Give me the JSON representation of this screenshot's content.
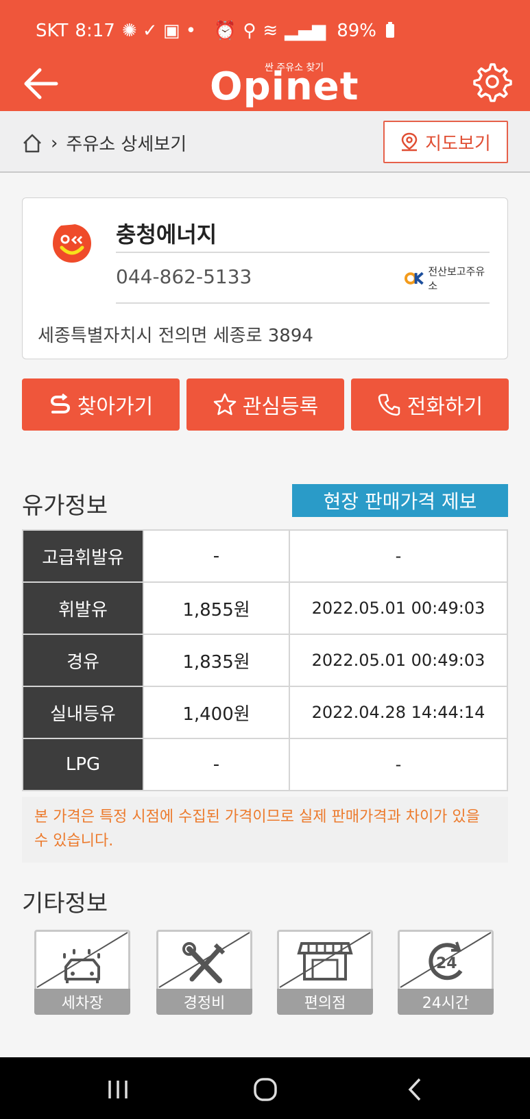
{
  "status_bar": {
    "carrier": "SKT",
    "time": "8:17",
    "battery": "89%"
  },
  "header": {
    "logo_sub": "싼 주유소 찾기",
    "logo_main": "Opinet"
  },
  "breadcrumb": {
    "current": "주유소 상세보기",
    "map_button": "지도보기"
  },
  "station": {
    "name": "충청에너지",
    "phone": "044-862-5133",
    "quality_badge": "전산보고주유소",
    "address": "세종특별자치시 전의면 세종로 3894",
    "brand_color": "#ef4b2a"
  },
  "actions": {
    "navigate": "찾아가기",
    "favorite": "관심등록",
    "call": "전화하기"
  },
  "prices": {
    "title": "유가정보",
    "report_button": "현장 판매가격 제보",
    "rows": [
      {
        "fuel": "고급휘발유",
        "price": "-",
        "time": "-"
      },
      {
        "fuel": "휘발유",
        "price": "1,855원",
        "time": "2022.05.01 00:49:03"
      },
      {
        "fuel": "경유",
        "price": "1,835원",
        "time": "2022.05.01 00:49:03"
      },
      {
        "fuel": "실내등유",
        "price": "1,400원",
        "time": "2022.04.28 14:44:14"
      },
      {
        "fuel": "LPG",
        "price": "-",
        "time": "-"
      }
    ],
    "notice": "본 가격은 특정 시점에 수집된 가격이므로 실제 판매가격과 차이가 있을 수 있습니다."
  },
  "other_info": {
    "title": "기타정보",
    "facilities": [
      {
        "label": "세차장",
        "icon": "car-wash-icon"
      },
      {
        "label": "경정비",
        "icon": "tools-icon"
      },
      {
        "label": "편의점",
        "icon": "store-icon"
      },
      {
        "label": "24시간",
        "icon": "clock-24-icon"
      }
    ]
  },
  "colors": {
    "accent": "#ef563b",
    "report_blue": "#2a9bc8",
    "notice_orange": "#ec7a2c"
  }
}
